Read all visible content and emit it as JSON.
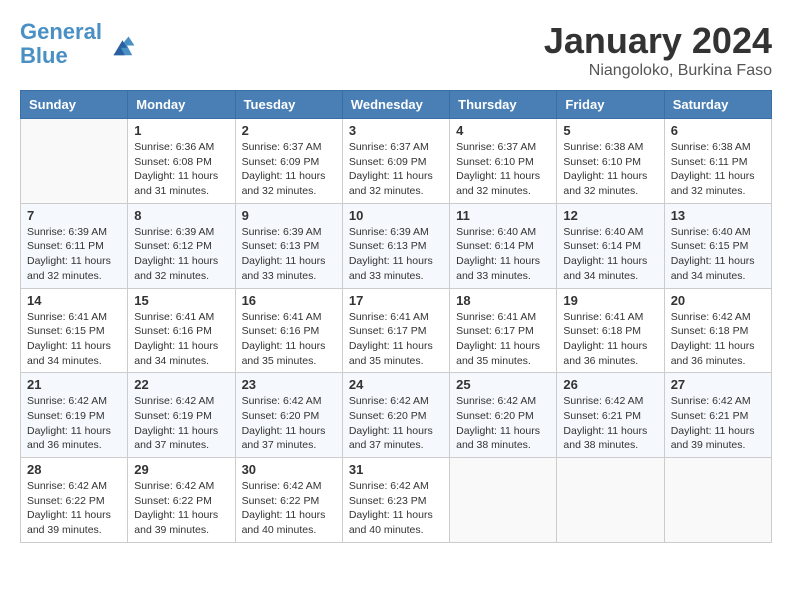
{
  "header": {
    "logo_line1": "General",
    "logo_line2": "Blue",
    "month": "January 2024",
    "location": "Niangoloko, Burkina Faso"
  },
  "weekdays": [
    "Sunday",
    "Monday",
    "Tuesday",
    "Wednesday",
    "Thursday",
    "Friday",
    "Saturday"
  ],
  "weeks": [
    [
      {
        "day": "",
        "sunrise": "",
        "sunset": "",
        "daylight": ""
      },
      {
        "day": "1",
        "sunrise": "Sunrise: 6:36 AM",
        "sunset": "Sunset: 6:08 PM",
        "daylight": "Daylight: 11 hours and 31 minutes."
      },
      {
        "day": "2",
        "sunrise": "Sunrise: 6:37 AM",
        "sunset": "Sunset: 6:09 PM",
        "daylight": "Daylight: 11 hours and 32 minutes."
      },
      {
        "day": "3",
        "sunrise": "Sunrise: 6:37 AM",
        "sunset": "Sunset: 6:09 PM",
        "daylight": "Daylight: 11 hours and 32 minutes."
      },
      {
        "day": "4",
        "sunrise": "Sunrise: 6:37 AM",
        "sunset": "Sunset: 6:10 PM",
        "daylight": "Daylight: 11 hours and 32 minutes."
      },
      {
        "day": "5",
        "sunrise": "Sunrise: 6:38 AM",
        "sunset": "Sunset: 6:10 PM",
        "daylight": "Daylight: 11 hours and 32 minutes."
      },
      {
        "day": "6",
        "sunrise": "Sunrise: 6:38 AM",
        "sunset": "Sunset: 6:11 PM",
        "daylight": "Daylight: 11 hours and 32 minutes."
      }
    ],
    [
      {
        "day": "7",
        "sunrise": "Sunrise: 6:39 AM",
        "sunset": "Sunset: 6:11 PM",
        "daylight": "Daylight: 11 hours and 32 minutes."
      },
      {
        "day": "8",
        "sunrise": "Sunrise: 6:39 AM",
        "sunset": "Sunset: 6:12 PM",
        "daylight": "Daylight: 11 hours and 32 minutes."
      },
      {
        "day": "9",
        "sunrise": "Sunrise: 6:39 AM",
        "sunset": "Sunset: 6:13 PM",
        "daylight": "Daylight: 11 hours and 33 minutes."
      },
      {
        "day": "10",
        "sunrise": "Sunrise: 6:39 AM",
        "sunset": "Sunset: 6:13 PM",
        "daylight": "Daylight: 11 hours and 33 minutes."
      },
      {
        "day": "11",
        "sunrise": "Sunrise: 6:40 AM",
        "sunset": "Sunset: 6:14 PM",
        "daylight": "Daylight: 11 hours and 33 minutes."
      },
      {
        "day": "12",
        "sunrise": "Sunrise: 6:40 AM",
        "sunset": "Sunset: 6:14 PM",
        "daylight": "Daylight: 11 hours and 34 minutes."
      },
      {
        "day": "13",
        "sunrise": "Sunrise: 6:40 AM",
        "sunset": "Sunset: 6:15 PM",
        "daylight": "Daylight: 11 hours and 34 minutes."
      }
    ],
    [
      {
        "day": "14",
        "sunrise": "Sunrise: 6:41 AM",
        "sunset": "Sunset: 6:15 PM",
        "daylight": "Daylight: 11 hours and 34 minutes."
      },
      {
        "day": "15",
        "sunrise": "Sunrise: 6:41 AM",
        "sunset": "Sunset: 6:16 PM",
        "daylight": "Daylight: 11 hours and 34 minutes."
      },
      {
        "day": "16",
        "sunrise": "Sunrise: 6:41 AM",
        "sunset": "Sunset: 6:16 PM",
        "daylight": "Daylight: 11 hours and 35 minutes."
      },
      {
        "day": "17",
        "sunrise": "Sunrise: 6:41 AM",
        "sunset": "Sunset: 6:17 PM",
        "daylight": "Daylight: 11 hours and 35 minutes."
      },
      {
        "day": "18",
        "sunrise": "Sunrise: 6:41 AM",
        "sunset": "Sunset: 6:17 PM",
        "daylight": "Daylight: 11 hours and 35 minutes."
      },
      {
        "day": "19",
        "sunrise": "Sunrise: 6:41 AM",
        "sunset": "Sunset: 6:18 PM",
        "daylight": "Daylight: 11 hours and 36 minutes."
      },
      {
        "day": "20",
        "sunrise": "Sunrise: 6:42 AM",
        "sunset": "Sunset: 6:18 PM",
        "daylight": "Daylight: 11 hours and 36 minutes."
      }
    ],
    [
      {
        "day": "21",
        "sunrise": "Sunrise: 6:42 AM",
        "sunset": "Sunset: 6:19 PM",
        "daylight": "Daylight: 11 hours and 36 minutes."
      },
      {
        "day": "22",
        "sunrise": "Sunrise: 6:42 AM",
        "sunset": "Sunset: 6:19 PM",
        "daylight": "Daylight: 11 hours and 37 minutes."
      },
      {
        "day": "23",
        "sunrise": "Sunrise: 6:42 AM",
        "sunset": "Sunset: 6:20 PM",
        "daylight": "Daylight: 11 hours and 37 minutes."
      },
      {
        "day": "24",
        "sunrise": "Sunrise: 6:42 AM",
        "sunset": "Sunset: 6:20 PM",
        "daylight": "Daylight: 11 hours and 37 minutes."
      },
      {
        "day": "25",
        "sunrise": "Sunrise: 6:42 AM",
        "sunset": "Sunset: 6:20 PM",
        "daylight": "Daylight: 11 hours and 38 minutes."
      },
      {
        "day": "26",
        "sunrise": "Sunrise: 6:42 AM",
        "sunset": "Sunset: 6:21 PM",
        "daylight": "Daylight: 11 hours and 38 minutes."
      },
      {
        "day": "27",
        "sunrise": "Sunrise: 6:42 AM",
        "sunset": "Sunset: 6:21 PM",
        "daylight": "Daylight: 11 hours and 39 minutes."
      }
    ],
    [
      {
        "day": "28",
        "sunrise": "Sunrise: 6:42 AM",
        "sunset": "Sunset: 6:22 PM",
        "daylight": "Daylight: 11 hours and 39 minutes."
      },
      {
        "day": "29",
        "sunrise": "Sunrise: 6:42 AM",
        "sunset": "Sunset: 6:22 PM",
        "daylight": "Daylight: 11 hours and 39 minutes."
      },
      {
        "day": "30",
        "sunrise": "Sunrise: 6:42 AM",
        "sunset": "Sunset: 6:22 PM",
        "daylight": "Daylight: 11 hours and 40 minutes."
      },
      {
        "day": "31",
        "sunrise": "Sunrise: 6:42 AM",
        "sunset": "Sunset: 6:23 PM",
        "daylight": "Daylight: 11 hours and 40 minutes."
      },
      {
        "day": "",
        "sunrise": "",
        "sunset": "",
        "daylight": ""
      },
      {
        "day": "",
        "sunrise": "",
        "sunset": "",
        "daylight": ""
      },
      {
        "day": "",
        "sunrise": "",
        "sunset": "",
        "daylight": ""
      }
    ]
  ]
}
